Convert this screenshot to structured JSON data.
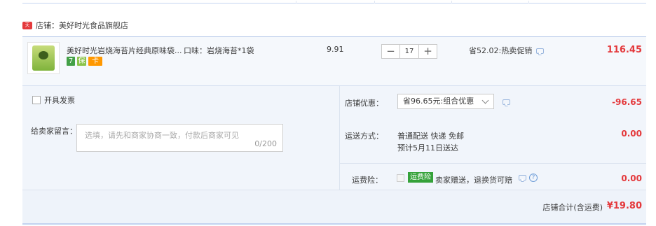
{
  "shop": {
    "icon_name": "shop-tmall-icon",
    "label": "店铺：",
    "name": "美好时光食品旗舰店"
  },
  "item": {
    "title": "美好时光岩烧海苔片经典原味袋...",
    "sku": "口味：岩烧海苔*1袋",
    "price": "9.91",
    "quantity": "17",
    "minus_label": "−",
    "plus_label": "+",
    "promo": "省52.02:热卖促销",
    "subtotal": "116.45",
    "badges": [
      "7",
      "保",
      "卡"
    ]
  },
  "invoice": {
    "label": "开具发票"
  },
  "message": {
    "label": "给卖家留言：",
    "placeholder": "选填，请先和商家协商一致，付款后商家可见",
    "counter": "0/200"
  },
  "discount": {
    "label": "店铺优惠：",
    "selected": "省96.65元:组合优惠",
    "amount": "-96.65"
  },
  "shipping": {
    "label": "运送方式：",
    "method": "普通配送 快递 免邮",
    "eta": "预计5月11日送达",
    "amount": "0.00"
  },
  "insurance": {
    "label": "运费险：",
    "tag": "运费险",
    "desc": "卖家赠送，退换货可赔",
    "amount": "0.00"
  },
  "footer": {
    "label": "店铺合计(含运费)",
    "total": "¥19.80"
  },
  "colors": {
    "accent_red": "#e4393c",
    "panel_bg": "#f1f5fb",
    "insurance_green": "#35a23a"
  }
}
